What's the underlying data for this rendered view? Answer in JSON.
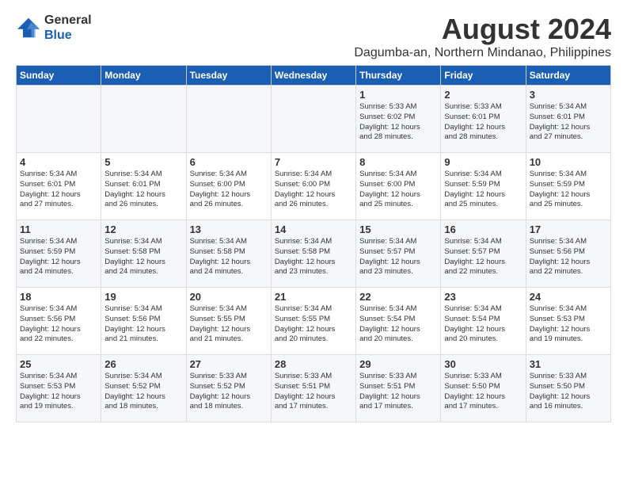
{
  "logo": {
    "line1": "General",
    "line2": "Blue"
  },
  "title": "August 2024",
  "location": "Dagumba-an, Northern Mindanao, Philippines",
  "days_of_week": [
    "Sunday",
    "Monday",
    "Tuesday",
    "Wednesday",
    "Thursday",
    "Friday",
    "Saturday"
  ],
  "weeks": [
    [
      {
        "day": "",
        "text": ""
      },
      {
        "day": "",
        "text": ""
      },
      {
        "day": "",
        "text": ""
      },
      {
        "day": "",
        "text": ""
      },
      {
        "day": "1",
        "text": "Sunrise: 5:33 AM\nSunset: 6:02 PM\nDaylight: 12 hours\nand 28 minutes."
      },
      {
        "day": "2",
        "text": "Sunrise: 5:33 AM\nSunset: 6:01 PM\nDaylight: 12 hours\nand 28 minutes."
      },
      {
        "day": "3",
        "text": "Sunrise: 5:34 AM\nSunset: 6:01 PM\nDaylight: 12 hours\nand 27 minutes."
      }
    ],
    [
      {
        "day": "4",
        "text": "Sunrise: 5:34 AM\nSunset: 6:01 PM\nDaylight: 12 hours\nand 27 minutes."
      },
      {
        "day": "5",
        "text": "Sunrise: 5:34 AM\nSunset: 6:01 PM\nDaylight: 12 hours\nand 26 minutes."
      },
      {
        "day": "6",
        "text": "Sunrise: 5:34 AM\nSunset: 6:00 PM\nDaylight: 12 hours\nand 26 minutes."
      },
      {
        "day": "7",
        "text": "Sunrise: 5:34 AM\nSunset: 6:00 PM\nDaylight: 12 hours\nand 26 minutes."
      },
      {
        "day": "8",
        "text": "Sunrise: 5:34 AM\nSunset: 6:00 PM\nDaylight: 12 hours\nand 25 minutes."
      },
      {
        "day": "9",
        "text": "Sunrise: 5:34 AM\nSunset: 5:59 PM\nDaylight: 12 hours\nand 25 minutes."
      },
      {
        "day": "10",
        "text": "Sunrise: 5:34 AM\nSunset: 5:59 PM\nDaylight: 12 hours\nand 25 minutes."
      }
    ],
    [
      {
        "day": "11",
        "text": "Sunrise: 5:34 AM\nSunset: 5:59 PM\nDaylight: 12 hours\nand 24 minutes."
      },
      {
        "day": "12",
        "text": "Sunrise: 5:34 AM\nSunset: 5:58 PM\nDaylight: 12 hours\nand 24 minutes."
      },
      {
        "day": "13",
        "text": "Sunrise: 5:34 AM\nSunset: 5:58 PM\nDaylight: 12 hours\nand 24 minutes."
      },
      {
        "day": "14",
        "text": "Sunrise: 5:34 AM\nSunset: 5:58 PM\nDaylight: 12 hours\nand 23 minutes."
      },
      {
        "day": "15",
        "text": "Sunrise: 5:34 AM\nSunset: 5:57 PM\nDaylight: 12 hours\nand 23 minutes."
      },
      {
        "day": "16",
        "text": "Sunrise: 5:34 AM\nSunset: 5:57 PM\nDaylight: 12 hours\nand 22 minutes."
      },
      {
        "day": "17",
        "text": "Sunrise: 5:34 AM\nSunset: 5:56 PM\nDaylight: 12 hours\nand 22 minutes."
      }
    ],
    [
      {
        "day": "18",
        "text": "Sunrise: 5:34 AM\nSunset: 5:56 PM\nDaylight: 12 hours\nand 22 minutes."
      },
      {
        "day": "19",
        "text": "Sunrise: 5:34 AM\nSunset: 5:56 PM\nDaylight: 12 hours\nand 21 minutes."
      },
      {
        "day": "20",
        "text": "Sunrise: 5:34 AM\nSunset: 5:55 PM\nDaylight: 12 hours\nand 21 minutes."
      },
      {
        "day": "21",
        "text": "Sunrise: 5:34 AM\nSunset: 5:55 PM\nDaylight: 12 hours\nand 20 minutes."
      },
      {
        "day": "22",
        "text": "Sunrise: 5:34 AM\nSunset: 5:54 PM\nDaylight: 12 hours\nand 20 minutes."
      },
      {
        "day": "23",
        "text": "Sunrise: 5:34 AM\nSunset: 5:54 PM\nDaylight: 12 hours\nand 20 minutes."
      },
      {
        "day": "24",
        "text": "Sunrise: 5:34 AM\nSunset: 5:53 PM\nDaylight: 12 hours\nand 19 minutes."
      }
    ],
    [
      {
        "day": "25",
        "text": "Sunrise: 5:34 AM\nSunset: 5:53 PM\nDaylight: 12 hours\nand 19 minutes."
      },
      {
        "day": "26",
        "text": "Sunrise: 5:34 AM\nSunset: 5:52 PM\nDaylight: 12 hours\nand 18 minutes."
      },
      {
        "day": "27",
        "text": "Sunrise: 5:33 AM\nSunset: 5:52 PM\nDaylight: 12 hours\nand 18 minutes."
      },
      {
        "day": "28",
        "text": "Sunrise: 5:33 AM\nSunset: 5:51 PM\nDaylight: 12 hours\nand 17 minutes."
      },
      {
        "day": "29",
        "text": "Sunrise: 5:33 AM\nSunset: 5:51 PM\nDaylight: 12 hours\nand 17 minutes."
      },
      {
        "day": "30",
        "text": "Sunrise: 5:33 AM\nSunset: 5:50 PM\nDaylight: 12 hours\nand 17 minutes."
      },
      {
        "day": "31",
        "text": "Sunrise: 5:33 AM\nSunset: 5:50 PM\nDaylight: 12 hours\nand 16 minutes."
      }
    ]
  ]
}
